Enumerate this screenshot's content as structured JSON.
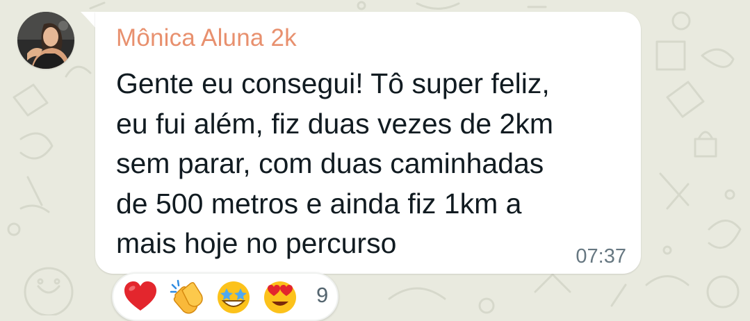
{
  "message": {
    "sender": "Mônica Aluna 2k",
    "lines": [
      "Gente eu consegui! Tô super feliz,",
      "eu fui além, fiz duas vezes de 2km",
      "sem parar, com duas caminhadas",
      "de 500 metros e ainda fiz 1km a",
      "mais hoje no percurso"
    ],
    "time": "07:37"
  },
  "reactions": {
    "emojis": [
      "heart-emoji",
      "clapping-hands-emoji",
      "star-struck-emoji",
      "heart-eyes-emoji"
    ],
    "count": "9"
  },
  "colors": {
    "wallpaper": "#e9eadf",
    "bubble": "#ffffff",
    "sender_name": "#e8906e",
    "text": "#111b21",
    "timestamp": "#667781"
  }
}
